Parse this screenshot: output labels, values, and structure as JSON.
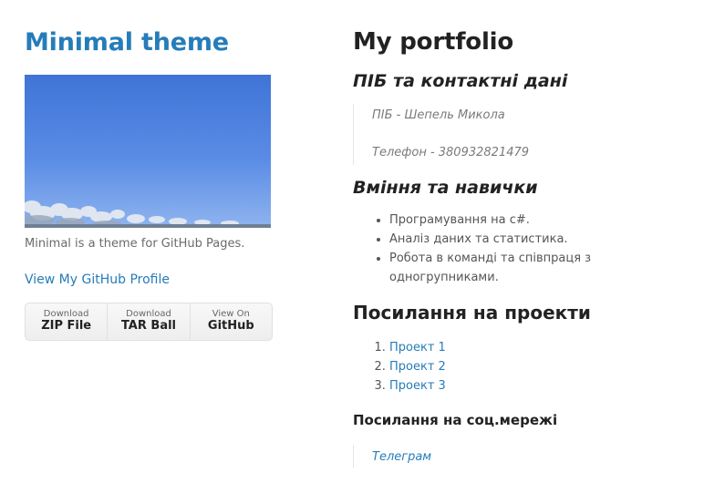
{
  "sidebar": {
    "title": "Minimal theme",
    "tagline": "Minimal is a theme for GitHub Pages.",
    "profile_link": "View My GitHub Profile",
    "downloads": [
      {
        "small": "Download",
        "big": "ZIP File"
      },
      {
        "small": "Download",
        "big": "TAR Ball"
      },
      {
        "small": "View On",
        "big": "GitHub"
      }
    ]
  },
  "main": {
    "title": "My portfolio",
    "contacts_heading": "ПІБ та контактні дані",
    "contacts": [
      "ПІБ - Шепель Микола",
      "Телефон - 380932821479"
    ],
    "skills_heading": "Вміння та навички",
    "skills": [
      "Програмування на c#.",
      "Аналіз даних та статистика.",
      "Робота в команді та співпраця з одногрупниками."
    ],
    "projects_heading": "Посилання на проекти",
    "projects": [
      "Проект 1",
      "Проект 2",
      "Проект 3"
    ],
    "social_heading": "Посилання на соц.мережі",
    "social": [
      "Телеграм"
    ]
  },
  "colors": {
    "link": "#267CB9",
    "heading": "#222222",
    "text": "#595959"
  }
}
